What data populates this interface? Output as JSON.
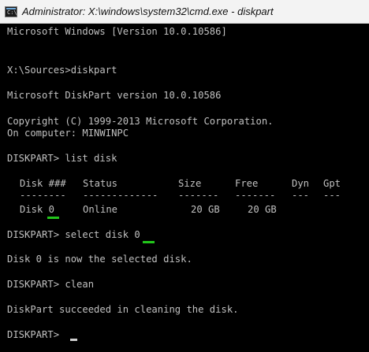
{
  "window": {
    "title": "Administrator: X:\\windows\\system32\\cmd.exe - diskpart",
    "icon_label": "C:\\"
  },
  "console": {
    "version_line": "Microsoft Windows [Version 10.0.10586]",
    "command_prompt": "X:\\Sources>diskpart",
    "diskpart_version": "Microsoft DiskPart version 10.0.10586",
    "copyright": "Copyright (C) 1999-2013 Microsoft Corporation.",
    "computer": "On computer: MINWINPC",
    "cmd_list": "DISKPART> list disk",
    "table": {
      "headers": [
        "Disk ###",
        "Status",
        "Size",
        "Free",
        "Dyn",
        "Gpt"
      ],
      "separators": [
        "--------",
        "-------------",
        "-------",
        "-------",
        "---",
        "---"
      ],
      "row": [
        "Disk 0",
        "Online",
        "20 GB",
        "20 GB",
        "",
        ""
      ]
    },
    "cmd_select": "DISKPART> select disk 0",
    "select_result": "Disk 0 is now the selected disk.",
    "cmd_clean": "DISKPART> clean",
    "clean_result": "DiskPart succeeded in cleaning the disk.",
    "final_prompt": "DISKPART> "
  },
  "colors": {
    "background": "#000000",
    "text": "#c0c0c0",
    "highlight_underline": "#22c51b",
    "titlebar": "#f3f3f3"
  }
}
